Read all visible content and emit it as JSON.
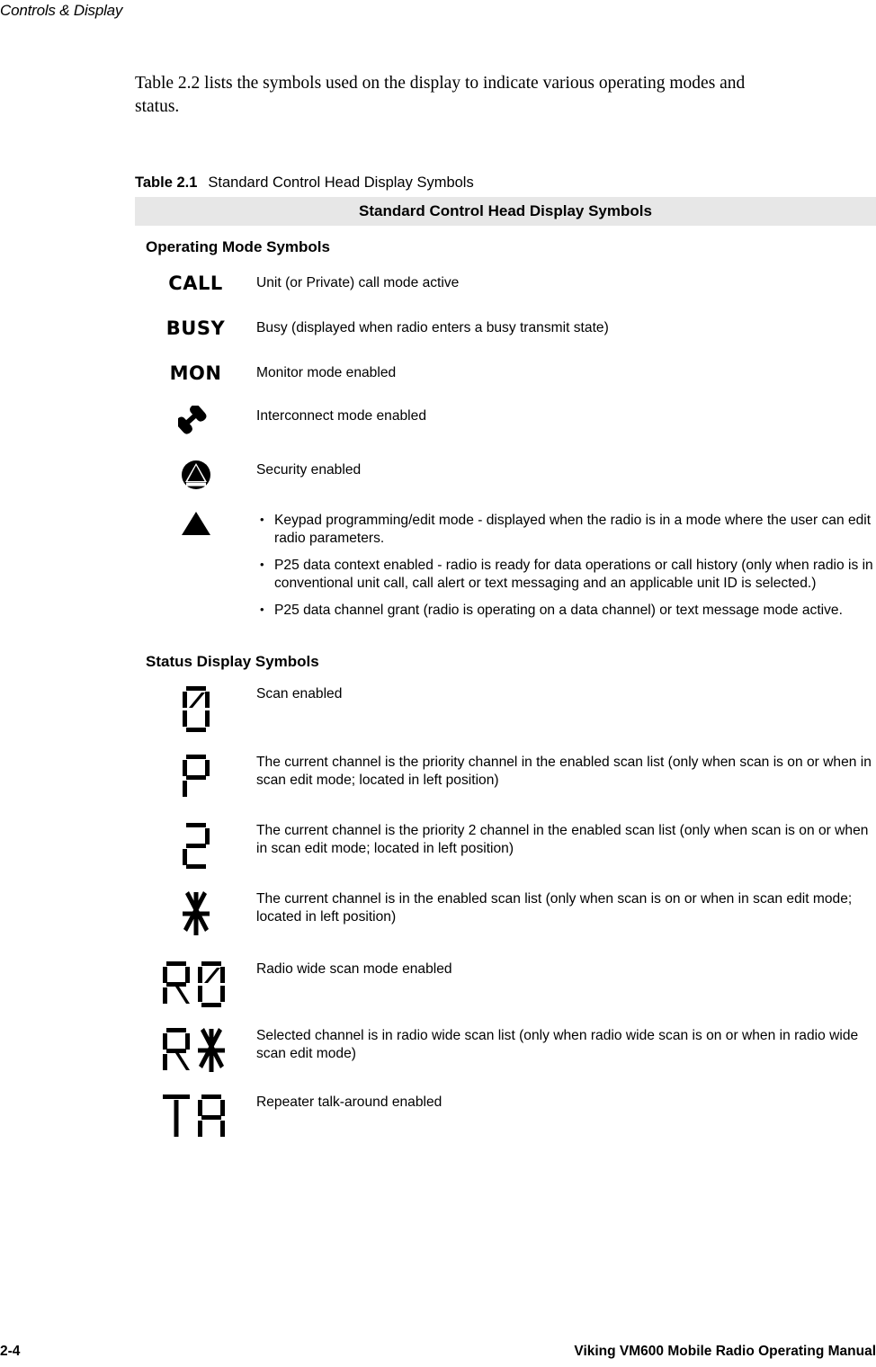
{
  "header": {
    "running_head": "Controls & Display"
  },
  "intro": {
    "paragraph": "Table 2.2 lists the symbols used on the display to indicate various operating modes and status."
  },
  "table": {
    "caption_label": "Table 2.1",
    "caption_title": "Standard Control Head Display Symbols",
    "header_bar": "Standard Control Head Display Symbols",
    "sections": [
      {
        "heading": "Operating Mode Symbols",
        "rows": [
          {
            "symbol_kind": "text",
            "symbol_text": "CALL",
            "symbol_name": "call-symbol",
            "description": "Unit (or Private) call mode active"
          },
          {
            "symbol_kind": "text",
            "symbol_text": "BUSY",
            "symbol_name": "busy-symbol",
            "description": "Busy (displayed when radio enters a busy transmit state)"
          },
          {
            "symbol_kind": "text",
            "symbol_text": "MON",
            "symbol_name": "mon-symbol",
            "description": "Monitor mode enabled"
          },
          {
            "symbol_kind": "icon",
            "symbol_name": "phone-handset-icon",
            "description": "Interconnect mode enabled"
          },
          {
            "symbol_kind": "icon",
            "symbol_name": "security-lock-icon",
            "description": "Security enabled"
          },
          {
            "symbol_kind": "icon",
            "symbol_name": "triangle-icon",
            "bullets": [
              "Keypad programming/edit mode - displayed when the radio is in a mode where the user can edit radio parameters.",
              "P25 data context enabled - radio is ready for data operations or call history (only when radio is in conventional unit call, call alert or text messaging and an applicable unit ID is selected.)",
              "P25 data channel grant (radio is operating on a data channel) or text message mode active."
            ]
          }
        ]
      },
      {
        "heading": "Status Display Symbols",
        "rows": [
          {
            "symbol_kind": "segment",
            "symbol_name": "slashed-zero-segment-icon",
            "description": "Scan enabled"
          },
          {
            "symbol_kind": "segment",
            "symbol_name": "letter-p-segment-icon",
            "description": "The current channel is the priority channel in the enabled scan list (only when scan is on or when in scan edit mode; located in left position)"
          },
          {
            "symbol_kind": "segment",
            "symbol_name": "digit-two-segment-icon",
            "description": "The current channel is the priority 2 channel in the enabled scan list (only when scan is on or when in scan edit mode; located in left position)"
          },
          {
            "symbol_kind": "segment",
            "symbol_name": "asterisk-segment-icon",
            "description": "The current channel is in the enabled scan list (only when scan is on or when in scan edit mode; located in left position)"
          },
          {
            "symbol_kind": "segment",
            "symbol_name": "r-slashed-zero-segment-icon",
            "description": "Radio wide scan mode enabled"
          },
          {
            "symbol_kind": "segment",
            "symbol_name": "r-asterisk-segment-icon",
            "description": "Selected channel is in radio wide scan list (only when radio wide scan is on or when in radio wide scan edit mode)"
          },
          {
            "symbol_kind": "segment",
            "symbol_name": "ta-segment-icon",
            "description": "Repeater talk-around enabled"
          }
        ]
      }
    ]
  },
  "footer": {
    "page_number": "2-4",
    "manual_title": "Viking VM600 Mobile Radio Operating Manual"
  },
  "colors": {
    "header_bar_bg": "#e7e7e7",
    "text": "#000000",
    "page_bg": "#ffffff"
  }
}
